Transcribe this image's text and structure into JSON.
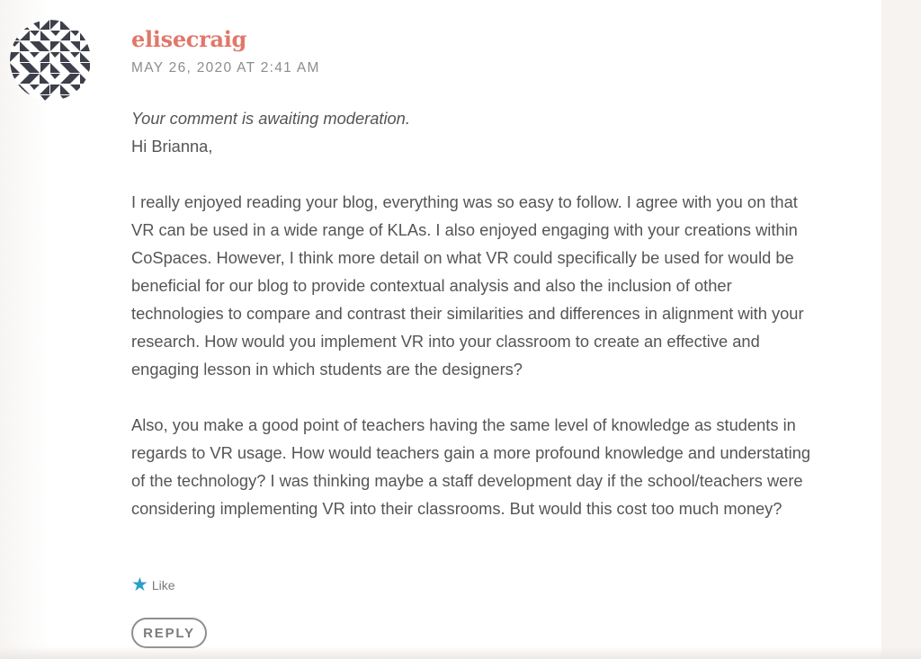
{
  "comment": {
    "author": "elisecraig",
    "timestamp": "MAY 26, 2020 AT 2:41 AM",
    "moderation_notice": "Your comment is awaiting moderation.",
    "paragraphs": [
      "Hi Brianna,",
      "I really enjoyed reading your blog, everything was so easy to follow. I agree with you on that VR can be used in a wide range of KLAs. I also enjoyed engaging with your creations within CoSpaces. However, I think more detail on what VR could specifically be used for would be beneficial for our blog to provide contextual analysis and also the inclusion of other technologies to compare and contrast their similarities and differences in alignment with your research. How would you implement VR into your classroom to create an effective and engaging lesson in which students are the designers?",
      "Also, you make a good point of teachers having the same level of knowledge as students in regards to VR usage. How would teachers gain a more profound knowledge and understating of the technology? I was thinking maybe a staff development day if the school/teachers were considering implementing VR into their classrooms. But would this cost too much money?"
    ]
  },
  "actions": {
    "like_label": "Like",
    "like_icon": "star-icon",
    "reply_label": "REPLY"
  },
  "colors": {
    "author": "#e1776a",
    "like_star": "#2c9dcd",
    "body_text": "#555555",
    "avatar_pattern": "#3d3f4a"
  }
}
